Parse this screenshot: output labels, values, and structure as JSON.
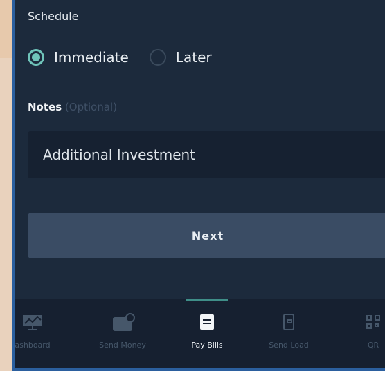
{
  "schedule": {
    "label": "Schedule",
    "options": [
      {
        "label": "Immediate",
        "selected": true
      },
      {
        "label": "Later",
        "selected": false
      }
    ]
  },
  "notes": {
    "label": "Notes",
    "optional": "(Optional)",
    "value": "Additional Investment"
  },
  "next_button": "Next",
  "bottom_nav": {
    "items": [
      {
        "label": "ashboard",
        "icon": "dashboard-icon"
      },
      {
        "label": "Send Money",
        "icon": "wallet-icon"
      },
      {
        "label": "Pay Bills",
        "icon": "bill-icon",
        "active": true
      },
      {
        "label": "Send Load",
        "icon": "phone-icon"
      },
      {
        "label": "QR",
        "icon": "qr-icon"
      }
    ]
  },
  "colors": {
    "accent": "#6fc4ba",
    "background": "#1c2a3c",
    "button": "#3a4c64"
  }
}
